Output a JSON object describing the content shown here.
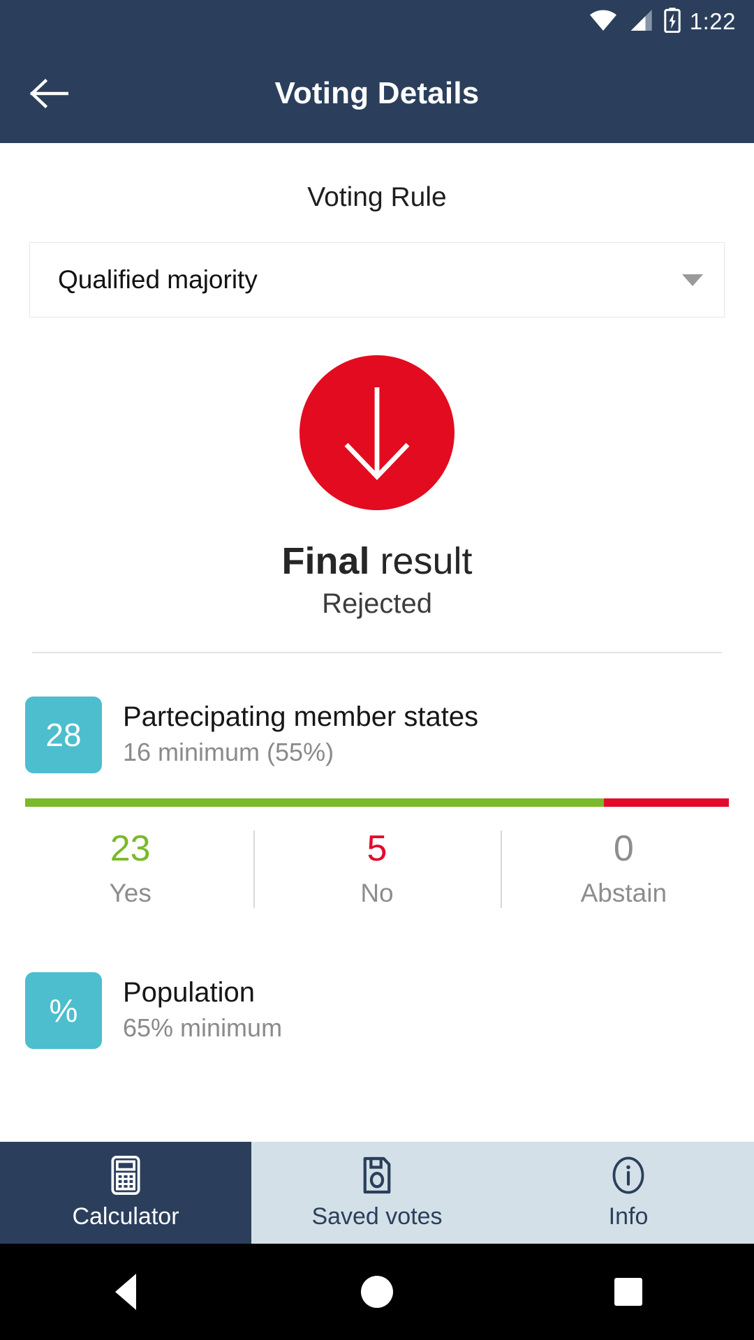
{
  "status_bar": {
    "time": "1:22",
    "icons": [
      "wifi-icon",
      "cellular-signal-icon",
      "battery-charging-icon"
    ]
  },
  "app_bar": {
    "title": "Voting Details",
    "back_icon": "arrow-left-icon"
  },
  "voting_rule": {
    "label": "Voting Rule",
    "selected": "Qualified majority",
    "caret_icon": "chevron-down-icon"
  },
  "result": {
    "icon": "arrow-down-icon",
    "icon_color": "#e30b1f",
    "title_strong": "Final",
    "title_light": " result",
    "status": "Rejected"
  },
  "criteria": [
    {
      "badge": "28",
      "badge_color": "#4cbecd",
      "title": "Partecipating member states",
      "subtitle": "16 minimum (55%)",
      "tally": [
        {
          "count": "23",
          "label": "Yes",
          "color": "#7ab929"
        },
        {
          "count": "5",
          "label": "No",
          "color": "#e30b2c"
        },
        {
          "count": "0",
          "label": "Abstain",
          "color": "#8d8d8d"
        }
      ]
    },
    {
      "badge": "%",
      "badge_color": "#4cbecd",
      "title": "Population",
      "subtitle": "65% minimum"
    }
  ],
  "chart_data": {
    "type": "bar",
    "title": "Partecipating member states",
    "categories": [
      "Yes",
      "No",
      "Abstain"
    ],
    "values": [
      23,
      5,
      0
    ],
    "total": 28,
    "minimum_required": 16,
    "minimum_percent": 55,
    "colors": [
      "#7ab929",
      "#e30b2c",
      "#bdbdbd"
    ],
    "orientation": "horizontal-stacked",
    "xlabel": "",
    "ylabel": "",
    "legend": [
      "Yes",
      "No",
      "Abstain"
    ]
  },
  "bottom_nav": {
    "items": [
      {
        "label": "Calculator",
        "icon": "calculator-icon",
        "active": true
      },
      {
        "label": "Saved votes",
        "icon": "floppy-save-icon",
        "active": false
      },
      {
        "label": "Info",
        "icon": "info-circle-icon",
        "active": false
      }
    ]
  },
  "android_nav": {
    "back": "triangle-back-icon",
    "home": "circle-home-icon",
    "recents": "square-recents-icon"
  }
}
